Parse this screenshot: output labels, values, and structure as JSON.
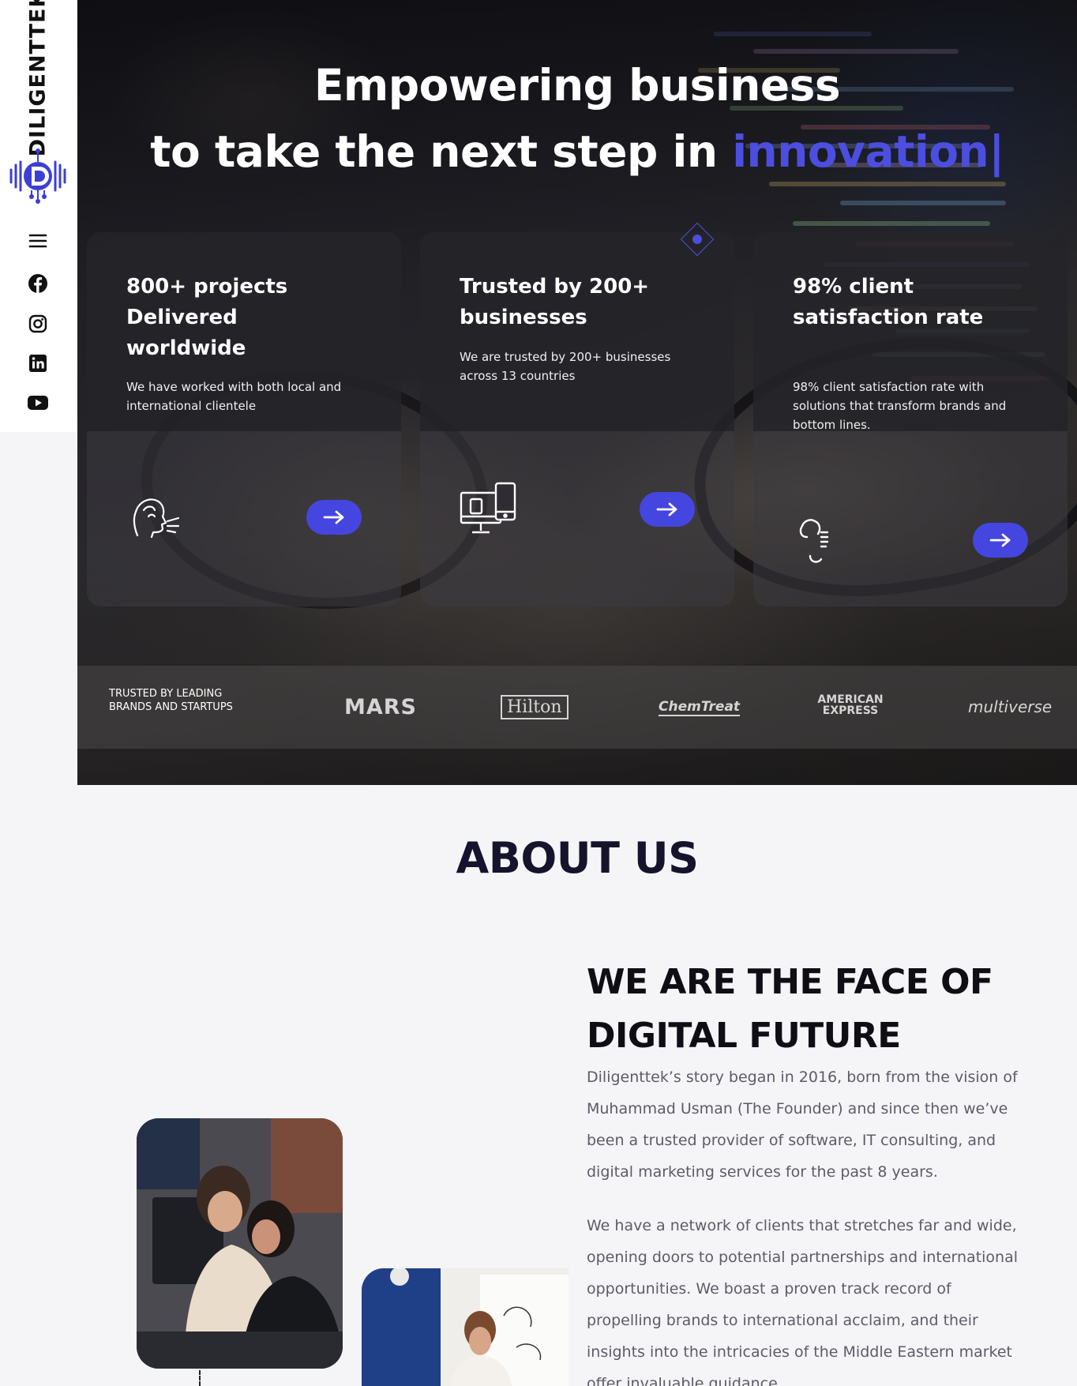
{
  "sidebar": {
    "brand": "DILIGENTTEK",
    "icons": [
      "menu-icon",
      "facebook-icon",
      "instagram-icon",
      "linkedin-icon",
      "youtube-icon"
    ]
  },
  "hero": {
    "line1": "Empowering business",
    "line2_prefix": "to take the next step in ",
    "line2_accent": "innovation|",
    "accent_color": "#4c4ee0",
    "cards": [
      {
        "title": "800+ projects Delivered worldwide",
        "text": "We have worked with both local and international clientele",
        "icon": "thinking-head-icon"
      },
      {
        "title": "Trusted by 200+ businesses",
        "text": "We are trusted by 200+ businesses across 13 countries",
        "icon": "devices-icon"
      },
      {
        "title": "98% client satisfaction rate",
        "text": "98% client satisfaction rate with solutions that transform brands and bottom lines.",
        "icon": "client-satisfaction-icon"
      }
    ],
    "brands_label": "TRUSTED BY LEADING BRANDS AND STARTUPS",
    "brands": [
      "MARS",
      "Hilton",
      "ChemTreat",
      "AMERICAN EXPRESS",
      "multiverse"
    ]
  },
  "about": {
    "title": "ABOUT US",
    "heading": "WE ARE THE FACE OF DIGITAL FUTURE",
    "p1": "Diligenttek’s story began in 2016, born from the vision of Muhammad Usman (The Founder) and since then we’ve been a trusted provider of software, IT consulting, and digital marketing services for the past 8 years.",
    "p2": "We have a network of clients that stretches far and wide, opening doors to potential partnerships and international opportunities. We boast a proven track record of propelling brands to international acclaim, and their insights into the intricacies of the Middle Eastern market offer invaluable guidance."
  }
}
